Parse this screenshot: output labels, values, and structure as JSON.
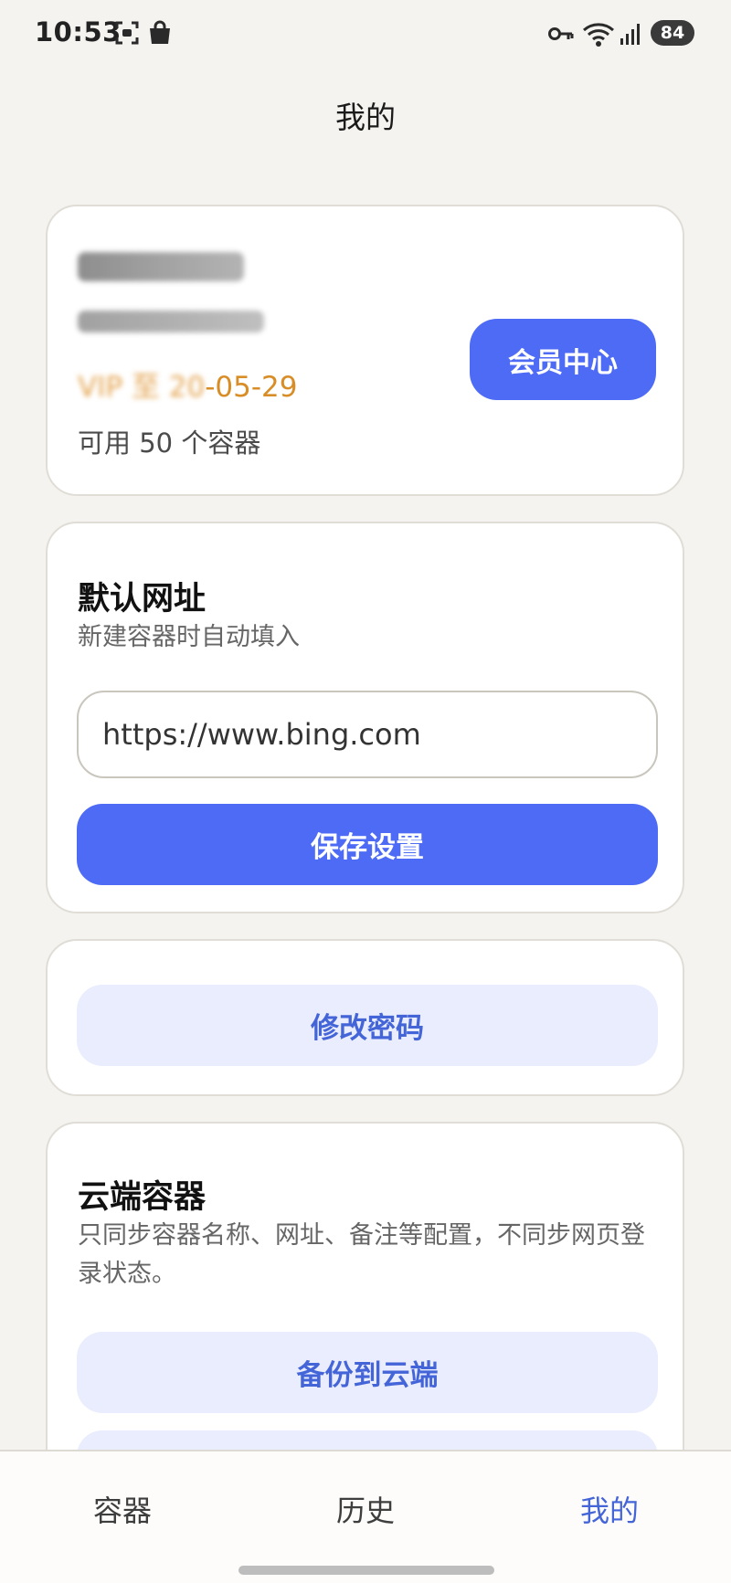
{
  "status_bar": {
    "time": "10:53",
    "battery": "84",
    "icons": [
      "screenshot-icon",
      "shopping-bag-icon",
      "key-icon",
      "wifi-icon",
      "signal-icon",
      "battery-icon"
    ]
  },
  "header": {
    "title": "我的"
  },
  "user_card": {
    "vip_prefix": "VIP 至 20",
    "vip_expiry_visible": "-05-29",
    "containers_available": "可用 50 个容器",
    "member_center_label": "会员中心"
  },
  "default_url": {
    "title": "默认网址",
    "description": "新建容器时自动填入",
    "input_value": "https://www.bing.com",
    "save_label": "保存设置"
  },
  "password": {
    "change_label": "修改密码"
  },
  "cloud": {
    "title": "云端容器",
    "description": "只同步容器名称、网址、备注等配置，不同步网页登录状态。",
    "backup_label": "备份到云端"
  },
  "nav": {
    "items": [
      {
        "label": "容器"
      },
      {
        "label": "历史"
      },
      {
        "label": "我的"
      }
    ]
  },
  "colors": {
    "accent": "#4d6bf5",
    "accent_text": "#4465d8",
    "soft_button": "#eaedfd",
    "vip_text": "#d88d27",
    "background": "#f4f3ef"
  }
}
